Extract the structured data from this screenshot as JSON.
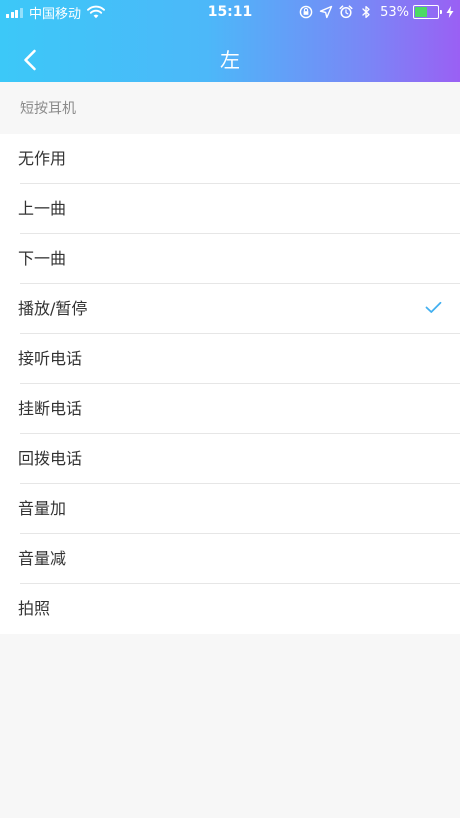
{
  "status_bar": {
    "carrier": "中国移动",
    "time": "15:11",
    "battery_percent": "53%",
    "battery_level": 0.53
  },
  "nav": {
    "title": "左",
    "back_icon": "chevron-left-icon"
  },
  "section": {
    "title": "短按耳机"
  },
  "options": [
    {
      "label": "无作用",
      "selected": false
    },
    {
      "label": "上一曲",
      "selected": false
    },
    {
      "label": "下一曲",
      "selected": false
    },
    {
      "label": "播放/暂停",
      "selected": true
    },
    {
      "label": "接听电话",
      "selected": false
    },
    {
      "label": "挂断电话",
      "selected": false
    },
    {
      "label": "回拨电话",
      "selected": false
    },
    {
      "label": "音量加",
      "selected": false
    },
    {
      "label": "音量减",
      "selected": false
    },
    {
      "label": "拍照",
      "selected": false
    }
  ],
  "colors": {
    "header_start": "#3cc8f8",
    "header_end": "#9a60f4",
    "check": "#43b0f0",
    "background": "#f7f7f7"
  }
}
